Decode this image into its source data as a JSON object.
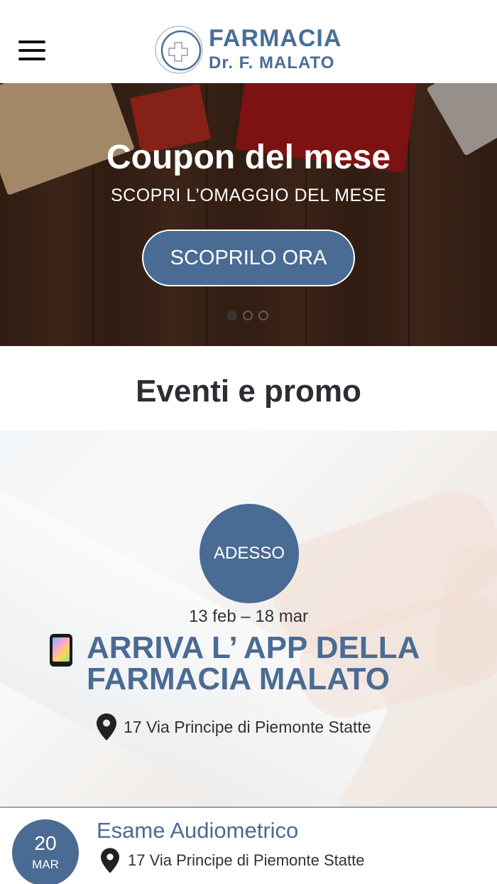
{
  "header": {
    "brand_title": "FARMACIA",
    "brand_subtitle": "Dr. F. MALATO",
    "accent_color": "#4a6e96"
  },
  "hero": {
    "title": "Coupon del mese",
    "subtitle": "SCOPRI L’OMAGGIO DEL MESE",
    "cta_label": "SCOPRILO ORA",
    "slides_total": 3,
    "active_slide": 1
  },
  "section": {
    "title": "Eventi e promo"
  },
  "featured_event": {
    "badge": "ADESSO",
    "date_range": "13 feb – 18 mar",
    "title": "ARRIVA L’ APP DELLA\nFARMACIA MALATO",
    "address": "17 Via Principe di Piemonte Statte",
    "icon": "mobile-phone-icon"
  },
  "events": [
    {
      "day": "20",
      "month": "MAR",
      "title": "Esame Audiometrico",
      "address": "17 Via Principe di Piemonte Statte"
    }
  ]
}
